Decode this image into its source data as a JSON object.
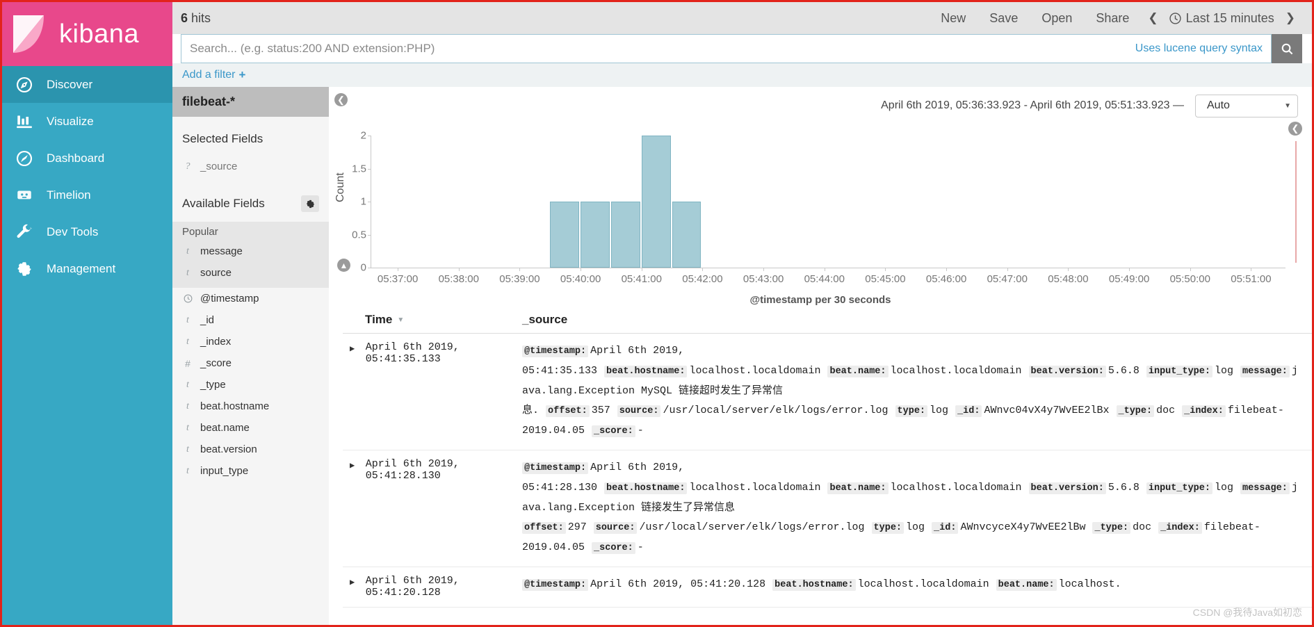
{
  "brand": {
    "name": "kibana"
  },
  "sidebar": {
    "items": [
      {
        "label": "Discover",
        "icon": "compass-icon",
        "active": true
      },
      {
        "label": "Visualize",
        "icon": "bar-chart-icon",
        "active": false
      },
      {
        "label": "Dashboard",
        "icon": "dashboard-icon",
        "active": false
      },
      {
        "label": "Timelion",
        "icon": "timelion-icon",
        "active": false
      },
      {
        "label": "Dev Tools",
        "icon": "wrench-icon",
        "active": false
      },
      {
        "label": "Management",
        "icon": "gear-icon",
        "active": false
      }
    ]
  },
  "topbar": {
    "hits_count": "6",
    "hits_label": "hits",
    "links": [
      "New",
      "Save",
      "Open",
      "Share"
    ],
    "prev_icon": "chevron-left-icon",
    "next_icon": "chevron-right-icon",
    "time_range_label": "Last 15 minutes",
    "clock_icon": "clock-icon"
  },
  "search": {
    "placeholder": "Search... (e.g. status:200 AND extension:PHP)",
    "value": "",
    "hint": "Uses lucene query syntax",
    "button_icon": "search-icon"
  },
  "filter": {
    "label": "Add a filter",
    "plus": "+"
  },
  "fields": {
    "index_pattern": "filebeat-*",
    "selected_heading": "Selected Fields",
    "selected": [
      {
        "type": "?",
        "name": "_source"
      }
    ],
    "available_heading": "Available Fields",
    "gear_icon": "gear-icon",
    "popular_label": "Popular",
    "popular": [
      {
        "type": "t",
        "name": "message"
      },
      {
        "type": "t",
        "name": "source"
      }
    ],
    "available": [
      {
        "type": "date",
        "name": "@timestamp"
      },
      {
        "type": "t",
        "name": "_id"
      },
      {
        "type": "t",
        "name": "_index"
      },
      {
        "type": "#",
        "name": "_score"
      },
      {
        "type": "t",
        "name": "_type"
      },
      {
        "type": "t",
        "name": "beat.hostname"
      },
      {
        "type": "t",
        "name": "beat.name"
      },
      {
        "type": "t",
        "name": "beat.version"
      },
      {
        "type": "t",
        "name": "input_type"
      }
    ]
  },
  "chart_header": {
    "range_text": "April 6th 2019, 05:36:33.923 - April 6th 2019, 05:51:33.923 —",
    "interval_value": "Auto",
    "caret_icon": "chevron-down-icon"
  },
  "chart_data": {
    "type": "bar",
    "title": "",
    "xlabel": "@timestamp per 30 seconds",
    "ylabel": "Count",
    "ylim": [
      0,
      2
    ],
    "yticks": [
      "0",
      "0.5",
      "1",
      "1.5",
      "2"
    ],
    "xticks": [
      "05:37:00",
      "05:38:00",
      "05:39:00",
      "05:40:00",
      "05:41:00",
      "05:42:00",
      "05:43:00",
      "05:44:00",
      "05:45:00",
      "05:46:00",
      "05:47:00",
      "05:48:00",
      "05:49:00",
      "05:50:00",
      "05:51:00"
    ],
    "x_start": "05:36:33.923",
    "x_end": "05:51:33.923",
    "bar_color": "#a5ccd6",
    "bar_border": "#7fb4c2",
    "categories": [
      "05:39:30",
      "05:40:00",
      "05:40:30",
      "05:41:00",
      "05:41:30"
    ],
    "values": [
      1,
      1,
      1,
      2,
      1
    ]
  },
  "doc_table": {
    "col_time": "Time",
    "col_source": "_source",
    "sort_icon": "caret-down-icon",
    "rows": [
      {
        "time": "April 6th 2019, 05:41:35.133",
        "pairs": [
          {
            "k": "@timestamp:",
            "v": "April 6th 2019, 05:41:35.133"
          },
          {
            "k": "beat.hostname:",
            "v": "localhost.localdomain"
          },
          {
            "k": "beat.name:",
            "v": "localhost.localdomain"
          },
          {
            "k": "beat.version:",
            "v": "5.6.8"
          },
          {
            "k": "input_type:",
            "v": "log"
          },
          {
            "k": "message:",
            "v": "java.lang.Exception MySQL 链接超时发生了异常信息."
          },
          {
            "k": "offset:",
            "v": "357"
          },
          {
            "k": "source:",
            "v": "/usr/local/server/elk/logs/error.log"
          },
          {
            "k": "type:",
            "v": "log"
          },
          {
            "k": "_id:",
            "v": "AWnvc04vX4y7WvEE2lBx"
          },
          {
            "k": "_type:",
            "v": "doc"
          },
          {
            "k": "_index:",
            "v": "filebeat-2019.04.05"
          },
          {
            "k": "_score:",
            "v": "-"
          }
        ]
      },
      {
        "time": "April 6th 2019, 05:41:28.130",
        "pairs": [
          {
            "k": "@timestamp:",
            "v": "April 6th 2019, 05:41:28.130"
          },
          {
            "k": "beat.hostname:",
            "v": "localhost.localdomain"
          },
          {
            "k": "beat.name:",
            "v": "localhost.localdomain"
          },
          {
            "k": "beat.version:",
            "v": "5.6.8"
          },
          {
            "k": "input_type:",
            "v": "log"
          },
          {
            "k": "message:",
            "v": "java.lang.Exception 链接发生了异常信息"
          },
          {
            "k": "offset:",
            "v": "297"
          },
          {
            "k": "source:",
            "v": "/usr/local/server/elk/logs/error.log"
          },
          {
            "k": "type:",
            "v": "log"
          },
          {
            "k": "_id:",
            "v": "AWnvcyceX4y7WvEE2lBw"
          },
          {
            "k": "_type:",
            "v": "doc"
          },
          {
            "k": "_index:",
            "v": "filebeat-2019.04.05"
          },
          {
            "k": "_score:",
            "v": "-"
          }
        ]
      },
      {
        "time": "April 6th 2019, 05:41:20.128",
        "pairs": [
          {
            "k": "@timestamp:",
            "v": "April 6th 2019, 05:41:20.128"
          },
          {
            "k": "beat.hostname:",
            "v": "localhost.localdomain"
          },
          {
            "k": "beat.name:",
            "v": "localhost."
          }
        ]
      }
    ]
  },
  "watermark": "CSDN @我待Java如初恋"
}
